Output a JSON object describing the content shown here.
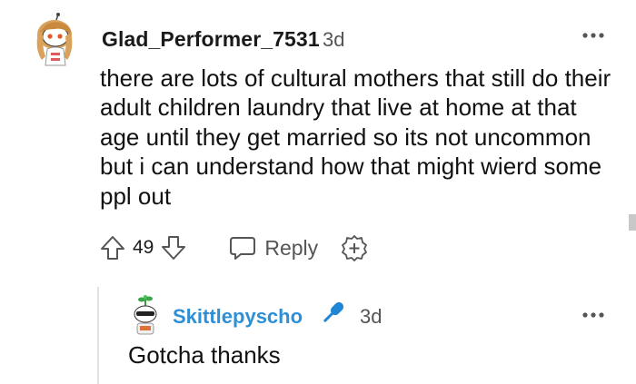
{
  "comment": {
    "username": "Glad_Performer_7531",
    "time": "3d",
    "body": "there are lots of cultural mothers that still do their adult children laundry that live at home at that age until they get married so its not uncommon but i can understand how that might wierd some ppl out",
    "votes": "49",
    "reply_label": "Reply",
    "icons": [
      "avatar",
      "more-options-icon",
      "upvote-icon",
      "downvote-icon",
      "reply-icon",
      "award-add-icon"
    ]
  },
  "reply": {
    "username": "Skittlepyscho",
    "time": "3d",
    "body": "Gotcha thanks",
    "icons": [
      "avatar",
      "microphone-icon",
      "more-options-icon"
    ]
  },
  "colors": {
    "username_reply": "#2e8fd6",
    "mic": "#1f86d6",
    "muted": "#555555"
  }
}
